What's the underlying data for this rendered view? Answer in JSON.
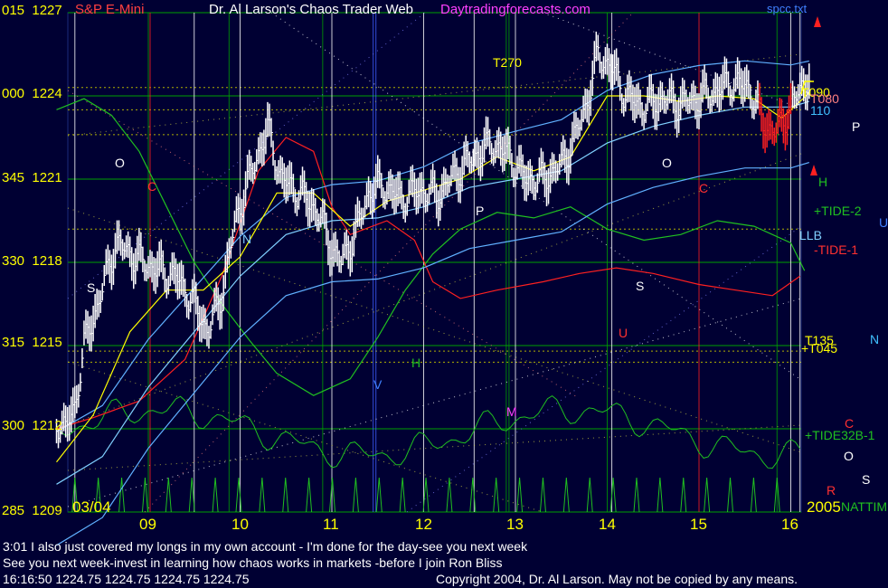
{
  "header": {
    "symbol": "S&P E-Mini",
    "title": "Dr. Al Larson's Chaos Trader Web",
    "site": "Daytradingforecasts.com",
    "ticker": "spcc.txt"
  },
  "y_labels": [
    {
      "time": "015",
      "price": "1227"
    },
    {
      "time": "000",
      "price": "1224"
    },
    {
      "time": "345",
      "price": "1221"
    },
    {
      "time": "330",
      "price": "1218"
    },
    {
      "time": "315",
      "price": "1215"
    },
    {
      "time": "300",
      "price": "1212"
    },
    {
      "time": "285",
      "price": "1209"
    }
  ],
  "x_labels": [
    "09",
    "10",
    "11",
    "12",
    "13",
    "14",
    "15",
    "16"
  ],
  "date_label": "03/04",
  "year_label": "2005",
  "right_labels": {
    "t090": "T090",
    "t080": "T080",
    "lab110": "110",
    "p": "P",
    "h": "H",
    "tide2": "+TIDE-2",
    "u": "U",
    "llb": "LLB",
    "tide1": "-TIDE-1",
    "t135": "T135",
    "t045": "+T045",
    "n": "N",
    "c": "C",
    "tide32": "+TIDE32B-1",
    "o": "O",
    "s": "S",
    "r": "R",
    "nattim": "NATTIM"
  },
  "inner_labels": {
    "t270": "T270",
    "o1": "O",
    "s1": "S",
    "n1": "N",
    "c1": "C",
    "h1": "H",
    "m": "M",
    "p1": "P",
    "o2": "O",
    "c2": "C",
    "s2": "S",
    "v": "V",
    "u1": "U"
  },
  "footer": {
    "line1": "3:01 I also just covered my longs in my own account - I'm done for the day-see you next week",
    "line2": "See you next week-invest in learning how chaos works in markets -before I join Ron Bliss",
    "status": "16:16:50  1224.75 1224.75 1224.75 1224.75",
    "copyright": "Copyright 2004, Dr. Al Larson. May not be copied by any means."
  },
  "colors": {
    "background": "#000033",
    "price_bars": "#ffffff",
    "cyan_ma": "#80d0ff",
    "yellow_ma": "#ffff00",
    "red_line": "#ff2020",
    "green_line": "#20c020",
    "grid_green": "#00a000",
    "grid_white": "#ffffff",
    "grid_blue": "#4060ff",
    "grid_red": "#ff2020"
  },
  "chart_data": {
    "type": "line",
    "title": "S&P E-Mini",
    "x_axis": {
      "labels": [
        "09",
        "10",
        "11",
        "12",
        "13",
        "14",
        "15",
        "16"
      ],
      "range": [
        "08:00",
        "16:15"
      ]
    },
    "y_axis": {
      "range": [
        1209,
        1227
      ],
      "ticks": [
        1209,
        1212,
        1215,
        1218,
        1221,
        1224,
        1227
      ]
    },
    "price_series": [
      {
        "t": 8.0,
        "v": 1212.3
      },
      {
        "t": 8.1,
        "v": 1212.0
      },
      {
        "t": 8.2,
        "v": 1212.8
      },
      {
        "t": 8.3,
        "v": 1215.0
      },
      {
        "t": 8.45,
        "v": 1216.5
      },
      {
        "t": 8.65,
        "v": 1218.7
      },
      {
        "t": 8.85,
        "v": 1218.2
      },
      {
        "t": 9.05,
        "v": 1217.8
      },
      {
        "t": 9.3,
        "v": 1217.5
      },
      {
        "t": 9.5,
        "v": 1216.5
      },
      {
        "t": 9.65,
        "v": 1215.5
      },
      {
        "t": 9.8,
        "v": 1216.8
      },
      {
        "t": 9.95,
        "v": 1219.5
      },
      {
        "t": 10.15,
        "v": 1221.5
      },
      {
        "t": 10.3,
        "v": 1222.8
      },
      {
        "t": 10.45,
        "v": 1221.0
      },
      {
        "t": 10.65,
        "v": 1220.5
      },
      {
        "t": 10.85,
        "v": 1219.8
      },
      {
        "t": 11.0,
        "v": 1218.5
      },
      {
        "t": 11.1,
        "v": 1218.0
      },
      {
        "t": 11.25,
        "v": 1219.0
      },
      {
        "t": 11.4,
        "v": 1220.5
      },
      {
        "t": 11.55,
        "v": 1220.8
      },
      {
        "t": 11.75,
        "v": 1220.3
      },
      {
        "t": 11.95,
        "v": 1220.6
      },
      {
        "t": 12.15,
        "v": 1220.4
      },
      {
        "t": 12.35,
        "v": 1221.2
      },
      {
        "t": 12.55,
        "v": 1221.8
      },
      {
        "t": 12.75,
        "v": 1222.3
      },
      {
        "t": 12.95,
        "v": 1221.8
      },
      {
        "t": 13.1,
        "v": 1221.0
      },
      {
        "t": 13.3,
        "v": 1221.0
      },
      {
        "t": 13.5,
        "v": 1221.5
      },
      {
        "t": 13.65,
        "v": 1222.5
      },
      {
        "t": 13.8,
        "v": 1224.0
      },
      {
        "t": 13.9,
        "v": 1225.5
      },
      {
        "t": 14.05,
        "v": 1225.0
      },
      {
        "t": 14.2,
        "v": 1224.0
      },
      {
        "t": 14.4,
        "v": 1223.6
      },
      {
        "t": 14.6,
        "v": 1223.9
      },
      {
        "t": 14.8,
        "v": 1223.7
      },
      {
        "t": 15.0,
        "v": 1223.9
      },
      {
        "t": 15.2,
        "v": 1224.2
      },
      {
        "t": 15.35,
        "v": 1224.5
      },
      {
        "t": 15.55,
        "v": 1224.3
      },
      {
        "t": 15.7,
        "v": 1223.0
      },
      {
        "t": 15.85,
        "v": 1222.7
      },
      {
        "t": 15.95,
        "v": 1223.3
      },
      {
        "t": 16.1,
        "v": 1224.2
      },
      {
        "t": 16.2,
        "v": 1224.75
      }
    ],
    "yellow_ma": [
      {
        "t": 8.0,
        "v": 1210.8
      },
      {
        "t": 8.4,
        "v": 1212.5
      },
      {
        "t": 8.8,
        "v": 1215.5
      },
      {
        "t": 9.2,
        "v": 1217.0
      },
      {
        "t": 9.6,
        "v": 1217.0
      },
      {
        "t": 10.0,
        "v": 1218.2
      },
      {
        "t": 10.4,
        "v": 1220.5
      },
      {
        "t": 10.8,
        "v": 1220.5
      },
      {
        "t": 11.2,
        "v": 1219.3
      },
      {
        "t": 11.6,
        "v": 1220.2
      },
      {
        "t": 12.0,
        "v": 1220.6
      },
      {
        "t": 12.4,
        "v": 1221.0
      },
      {
        "t": 12.8,
        "v": 1221.8
      },
      {
        "t": 13.2,
        "v": 1221.3
      },
      {
        "t": 13.6,
        "v": 1221.8
      },
      {
        "t": 14.0,
        "v": 1224.0
      },
      {
        "t": 14.4,
        "v": 1224.0
      },
      {
        "t": 14.8,
        "v": 1223.8
      },
      {
        "t": 15.2,
        "v": 1224.0
      },
      {
        "t": 15.6,
        "v": 1223.9
      },
      {
        "t": 15.9,
        "v": 1223.2
      },
      {
        "t": 16.2,
        "v": 1224.1
      }
    ],
    "cyan_ma": [
      {
        "t": 8.0,
        "v": 1210.0
      },
      {
        "t": 8.5,
        "v": 1211.0
      },
      {
        "t": 9.0,
        "v": 1213.5
      },
      {
        "t": 9.5,
        "v": 1215.5
      },
      {
        "t": 10.0,
        "v": 1217.5
      },
      {
        "t": 10.5,
        "v": 1219.0
      },
      {
        "t": 11.0,
        "v": 1219.5
      },
      {
        "t": 11.5,
        "v": 1219.6
      },
      {
        "t": 12.0,
        "v": 1220.0
      },
      {
        "t": 12.5,
        "v": 1220.7
      },
      {
        "t": 13.0,
        "v": 1221.0
      },
      {
        "t": 13.5,
        "v": 1221.3
      },
      {
        "t": 14.0,
        "v": 1222.3
      },
      {
        "t": 14.5,
        "v": 1222.9
      },
      {
        "t": 15.0,
        "v": 1223.3
      },
      {
        "t": 15.5,
        "v": 1223.6
      },
      {
        "t": 16.0,
        "v": 1223.6
      },
      {
        "t": 16.2,
        "v": 1223.8
      }
    ],
    "red_line": [
      {
        "t": 8.0,
        "v": 1212.0
      },
      {
        "t": 8.4,
        "v": 1212.4
      },
      {
        "t": 8.9,
        "v": 1213.0
      },
      {
        "t": 9.4,
        "v": 1214.5
      },
      {
        "t": 9.8,
        "v": 1217.5
      },
      {
        "t": 10.2,
        "v": 1221.3
      },
      {
        "t": 10.5,
        "v": 1222.5
      },
      {
        "t": 10.8,
        "v": 1222.0
      },
      {
        "t": 11.0,
        "v": 1220.0
      },
      {
        "t": 11.2,
        "v": 1219.0
      },
      {
        "t": 11.6,
        "v": 1219.5
      },
      {
        "t": 11.9,
        "v": 1218.8
      },
      {
        "t": 12.1,
        "v": 1217.3
      },
      {
        "t": 12.4,
        "v": 1216.7
      },
      {
        "t": 12.8,
        "v": 1217.0
      },
      {
        "t": 13.3,
        "v": 1217.3
      },
      {
        "t": 13.7,
        "v": 1217.6
      },
      {
        "t": 14.1,
        "v": 1217.8
      },
      {
        "t": 14.5,
        "v": 1217.6
      },
      {
        "t": 15.0,
        "v": 1217.2
      },
      {
        "t": 15.4,
        "v": 1217.0
      },
      {
        "t": 15.8,
        "v": 1216.8
      },
      {
        "t": 16.1,
        "v": 1217.5
      }
    ],
    "green_line": [
      {
        "t": 8.0,
        "v": 1223.5
      },
      {
        "t": 8.3,
        "v": 1223.9
      },
      {
        "t": 8.6,
        "v": 1223.3
      },
      {
        "t": 8.9,
        "v": 1222.0
      },
      {
        "t": 9.2,
        "v": 1220.0
      },
      {
        "t": 9.5,
        "v": 1218.0
      },
      {
        "t": 9.8,
        "v": 1216.5
      },
      {
        "t": 10.1,
        "v": 1215.2
      },
      {
        "t": 10.4,
        "v": 1214.0
      },
      {
        "t": 10.8,
        "v": 1213.2
      },
      {
        "t": 11.2,
        "v": 1213.8
      },
      {
        "t": 11.5,
        "v": 1215.3
      },
      {
        "t": 11.8,
        "v": 1217.0
      },
      {
        "t": 12.1,
        "v": 1218.3
      },
      {
        "t": 12.4,
        "v": 1219.2
      },
      {
        "t": 12.8,
        "v": 1219.8
      },
      {
        "t": 13.2,
        "v": 1219.6
      },
      {
        "t": 13.6,
        "v": 1220.0
      },
      {
        "t": 14.0,
        "v": 1219.2
      },
      {
        "t": 14.4,
        "v": 1218.8
      },
      {
        "t": 14.8,
        "v": 1219.0
      },
      {
        "t": 15.2,
        "v": 1219.5
      },
      {
        "t": 15.6,
        "v": 1219.3
      },
      {
        "t": 16.0,
        "v": 1218.7
      },
      {
        "t": 16.15,
        "v": 1217.7
      }
    ]
  }
}
